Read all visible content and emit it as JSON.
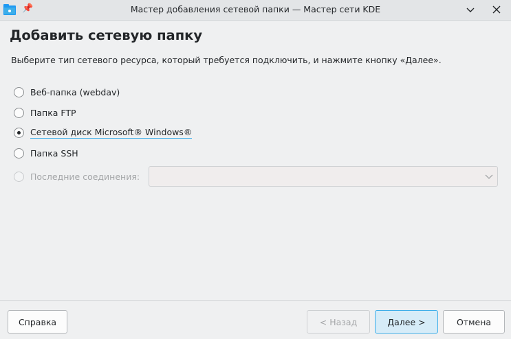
{
  "window": {
    "title": "Мастер добавления сетевой папки — Мастер сети KDE",
    "icons": {
      "app": "network-folder-icon",
      "pin": "pin-icon",
      "minimize": "chevron-down-icon",
      "close": "close-icon"
    }
  },
  "page": {
    "heading": "Добавить сетевую папку",
    "instruction": "Выберите тип сетевого ресурса, который требуется подключить, и нажмите кнопку «Далее»."
  },
  "options": [
    {
      "label": "Веб-папка (webdav)",
      "checked": false
    },
    {
      "label": "Папка FTP",
      "checked": false
    },
    {
      "label": "Сетевой диск Microsoft® Windows®",
      "checked": true
    },
    {
      "label": "Папка SSH",
      "checked": false
    },
    {
      "label": "Последние соединения:",
      "checked": false,
      "disabled": true
    }
  ],
  "recent_combo": {
    "value": "",
    "disabled": true
  },
  "buttons": {
    "help": "Справка",
    "back": "< Назад",
    "next": "Далее >",
    "cancel": "Отмена"
  },
  "colors": {
    "accent": "#3daee9",
    "background": "#eff0f1"
  }
}
